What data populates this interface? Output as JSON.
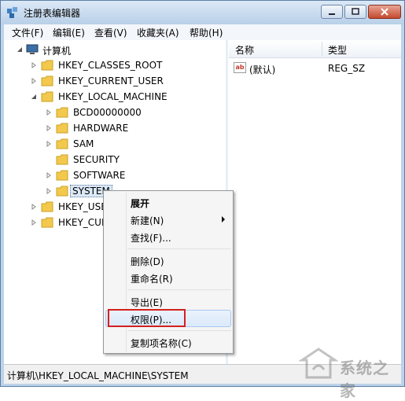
{
  "window": {
    "title": "注册表编辑器"
  },
  "menubar": {
    "items": [
      "文件(F)",
      "编辑(E)",
      "查看(V)",
      "收藏夹(A)",
      "帮助(H)"
    ]
  },
  "tree": {
    "root": "计算机",
    "hives": [
      "HKEY_CLASSES_ROOT",
      "HKEY_CURRENT_USER",
      "HKEY_LOCAL_MACHINE"
    ],
    "local_machine_children": [
      "BCD00000000",
      "HARDWARE",
      "SAM",
      "SECURITY",
      "SOFTWARE",
      "SYSTEM"
    ],
    "hives_after": [
      "HKEY_USERS",
      "HKEY_CURRENT_CONFIG"
    ],
    "hives_after_visible": [
      "HKEY_USE",
      "HKEY_CUR"
    ],
    "selected": "SYSTEM"
  },
  "list": {
    "columns": [
      "名称",
      "类型"
    ],
    "rows": [
      {
        "name": "(默认)",
        "type": "REG_SZ",
        "icon": "string-value-icon",
        "icon_text": "ab"
      }
    ]
  },
  "context_menu": {
    "items": [
      "展开",
      "新建(N)",
      "查找(F)...",
      "删除(D)",
      "重命名(R)",
      "导出(E)",
      "权限(P)...",
      "复制项名称(C)"
    ],
    "highlighted": "权限(P)..."
  },
  "statusbar": {
    "path": "计算机\\HKEY_LOCAL_MACHINE\\SYSTEM"
  },
  "watermark": {
    "text": "系统之家"
  },
  "colors": {
    "accent_red": "#d32020",
    "folder_yellow": "#f2c94c",
    "title_bar": "#bcd3ea"
  }
}
